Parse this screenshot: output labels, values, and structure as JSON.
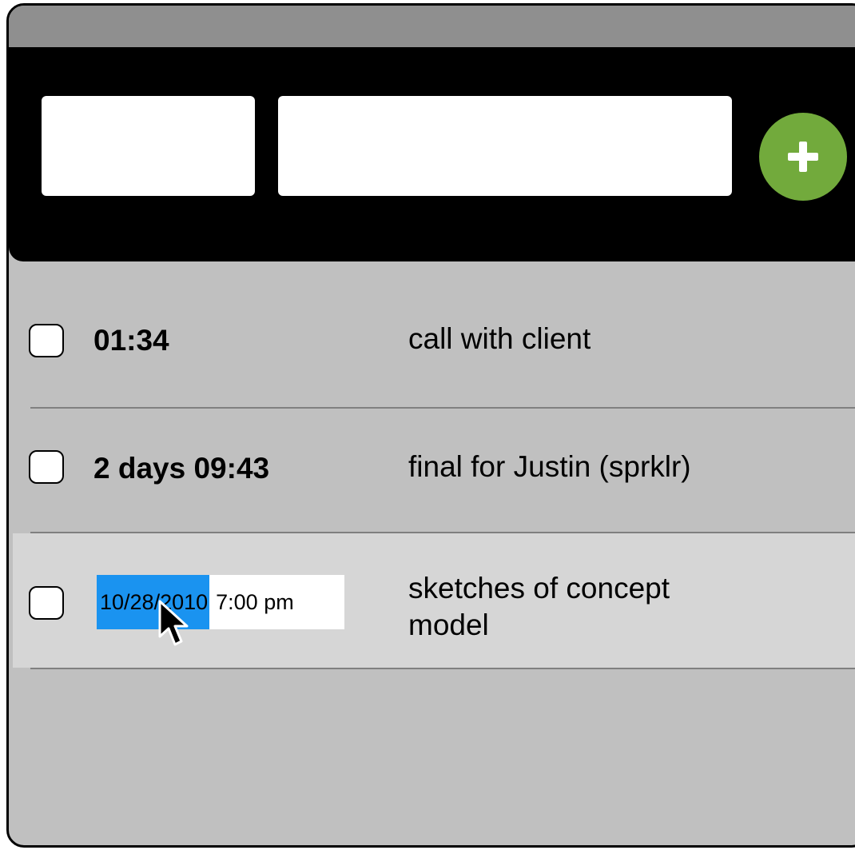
{
  "header": {
    "time_input_value": "",
    "task_input_value": "",
    "add_button_label": "+"
  },
  "tasks": [
    {
      "checked": false,
      "time": "01:34",
      "title": "call with client"
    },
    {
      "checked": false,
      "time": "2 days 09:43",
      "title": "final for Justin (sprklr)"
    },
    {
      "checked": false,
      "editing": true,
      "date_selected": "10/28/2010",
      "time_rest": "7:00 pm",
      "title_line1": "sketches of concept",
      "title_line2": "model"
    }
  ],
  "colors": {
    "titlebar": "#8f8f8f",
    "header": "#000000",
    "body": "#c0c0c0",
    "row_highlight": "#d6d6d6",
    "add_button": "#72aa3c",
    "selection": "#1a93f0"
  },
  "icons": {
    "add": "plus-icon",
    "pointer": "mouse-pointer-icon"
  }
}
